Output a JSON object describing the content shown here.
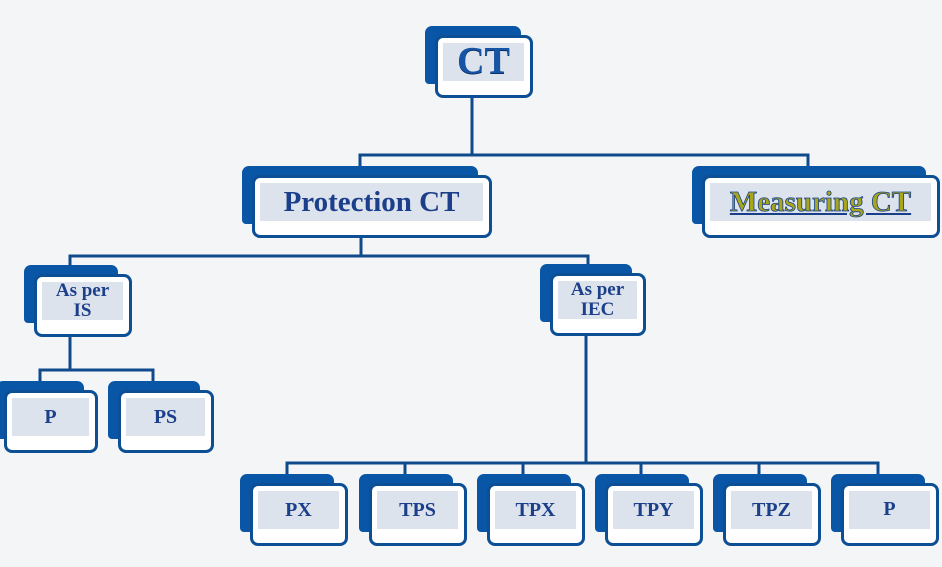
{
  "diagram": {
    "type": "hierarchy",
    "colors": {
      "background": "#f4f5f7",
      "box_back": "#0a56a6",
      "box_border": "#0d4f95",
      "box_fill": "#dde3ec",
      "text": "#1b3f8a",
      "link_text": "#a8a61c",
      "connector": "#0f4a8c"
    },
    "root": {
      "label": "CT"
    },
    "level1": {
      "protection": {
        "label": "Protection CT"
      },
      "measuring": {
        "label": "Measuring CT",
        "is_link": true
      }
    },
    "level2": {
      "as_per_is": {
        "label": "As per\nIS"
      },
      "as_per_iec": {
        "label": "As per\nIEC"
      }
    },
    "is_classes": [
      {
        "label": "P"
      },
      {
        "label": "PS"
      }
    ],
    "iec_classes": [
      {
        "label": "PX"
      },
      {
        "label": "TPS"
      },
      {
        "label": "TPX"
      },
      {
        "label": "TPY"
      },
      {
        "label": "TPZ"
      },
      {
        "label": "P"
      }
    ],
    "edges": [
      [
        "CT",
        "Protection CT"
      ],
      [
        "CT",
        "Measuring CT"
      ],
      [
        "Protection CT",
        "As per IS"
      ],
      [
        "Protection CT",
        "As per IEC"
      ],
      [
        "As per IS",
        "P"
      ],
      [
        "As per IS",
        "PS"
      ],
      [
        "As per IEC",
        "PX"
      ],
      [
        "As per IEC",
        "TPS"
      ],
      [
        "As per IEC",
        "TPX"
      ],
      [
        "As per IEC",
        "TPY"
      ],
      [
        "As per IEC",
        "TPZ"
      ],
      [
        "As per IEC",
        "P"
      ]
    ]
  }
}
